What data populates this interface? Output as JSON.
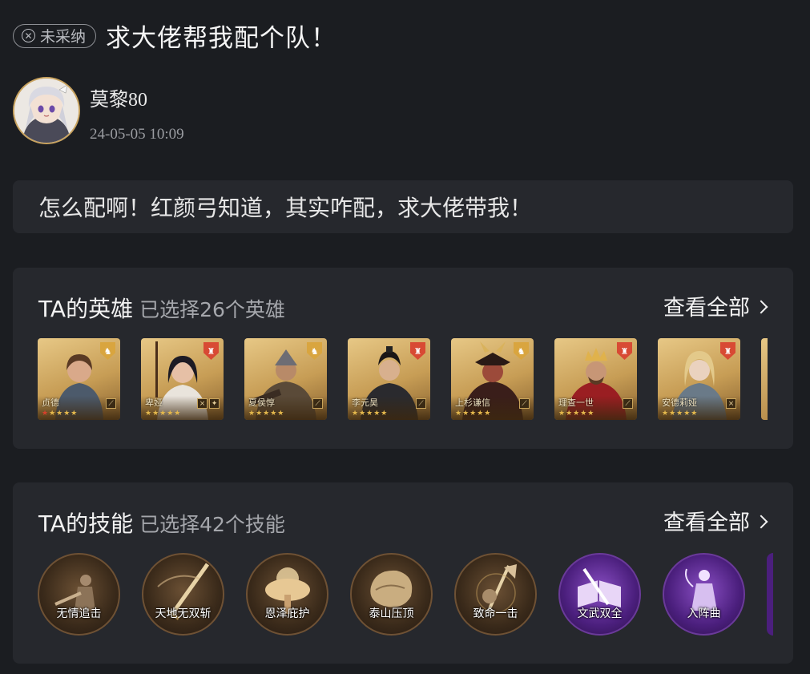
{
  "post": {
    "status_badge": "未采纳",
    "title": "求大佬帮我配个队！",
    "user": {
      "name": "莫黎80",
      "time": "24-05-05 10:09"
    },
    "question": "怎么配啊！红颜弓知道，其实咋配，求大佬带我！"
  },
  "heroes_section": {
    "title": "TA的英雄",
    "subtitle": "已选择26个英雄",
    "view_all": "查看全部",
    "items": [
      {
        "name": "贞德",
        "emblem": "gold",
        "stars": 5,
        "red_stars": 1
      },
      {
        "name": "卑娅",
        "emblem": "red",
        "stars": 5,
        "red_stars": 0
      },
      {
        "name": "夏侯惇",
        "emblem": "gold",
        "stars": 5,
        "red_stars": 0
      },
      {
        "name": "李元昊",
        "emblem": "red",
        "stars": 5,
        "red_stars": 0
      },
      {
        "name": "上杉谦信",
        "emblem": "gold",
        "stars": 5,
        "red_stars": 0
      },
      {
        "name": "理查一世",
        "emblem": "red",
        "stars": 5,
        "red_stars": 0
      },
      {
        "name": "安德莉娅",
        "emblem": "red",
        "stars": 5,
        "red_stars": 0
      }
    ]
  },
  "skills_section": {
    "title": "TA的技能",
    "subtitle": "已选择42个技能",
    "view_all": "查看全部",
    "items": [
      {
        "name": "无情追击",
        "tone": "gold"
      },
      {
        "name": "天地无双斩",
        "tone": "gold"
      },
      {
        "name": "恩泽庇护",
        "tone": "gold"
      },
      {
        "name": "泰山压顶",
        "tone": "gold"
      },
      {
        "name": "致命一击",
        "tone": "gold"
      },
      {
        "name": "文武双全",
        "tone": "purple"
      },
      {
        "name": "入阵曲",
        "tone": "purple"
      }
    ]
  },
  "colors": {
    "background": "#1b1d21",
    "card": "#26282d",
    "gold_accent": "#c9a35f",
    "red_emblem": "#d84a34",
    "gold_emblem": "#d9a53f"
  }
}
